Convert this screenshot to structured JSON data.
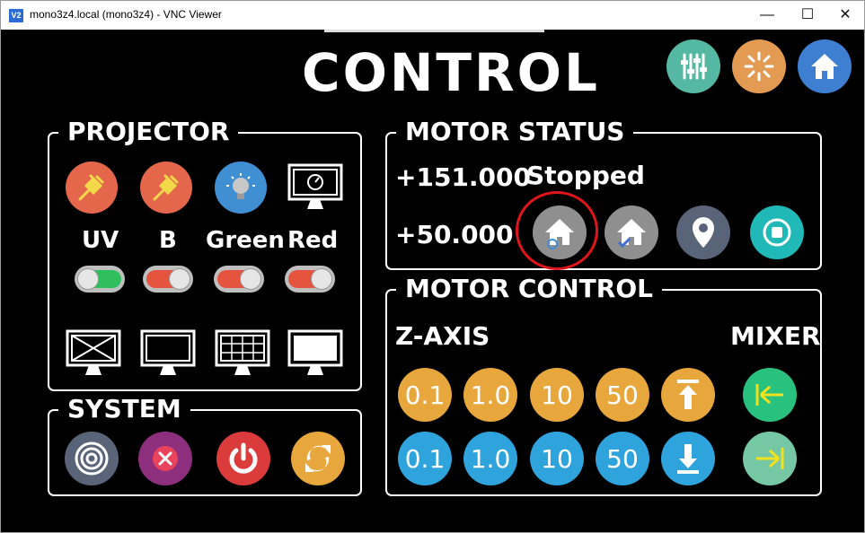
{
  "window": {
    "title": "mono3z4.local (mono3z4) - VNC Viewer",
    "app_icon_text": "V2",
    "minimize": "—",
    "maximize": "☐",
    "close": "✕"
  },
  "heading": "CONTROL",
  "projector": {
    "title": "PROJECTOR",
    "channels": [
      {
        "label": "UV",
        "toggle_on": true
      },
      {
        "label": "B",
        "toggle_on": false
      },
      {
        "label": "Green",
        "toggle_on": false
      },
      {
        "label": "Red",
        "toggle_on": false
      }
    ]
  },
  "system": {
    "title": "SYSTEM"
  },
  "motor_status": {
    "title": "MOTOR STATUS",
    "position_1": "+151.000",
    "state": "Stopped",
    "position_2": "+50.000"
  },
  "motor_control": {
    "title": "MOTOR CONTROL",
    "z_axis_label": "Z-AXIS",
    "mixer_label": "MIXER",
    "up_steps": [
      "0.1",
      "1.0",
      "10",
      "50"
    ],
    "down_steps": [
      "0.1",
      "1.0",
      "10",
      "50"
    ]
  },
  "colors": {
    "orange": "#e5674b",
    "blue": "#3f8fd2",
    "gold": "#e8a73c",
    "cyan_blue": "#2fa4dc",
    "green": "#29c17e",
    "teal": "#21b8b8",
    "red": "#dc3b3b",
    "purple": "#8e2f7d",
    "slate": "#5a6478",
    "grey_circle": "#8f8f8f",
    "highlight_ring": "#e0151b"
  }
}
